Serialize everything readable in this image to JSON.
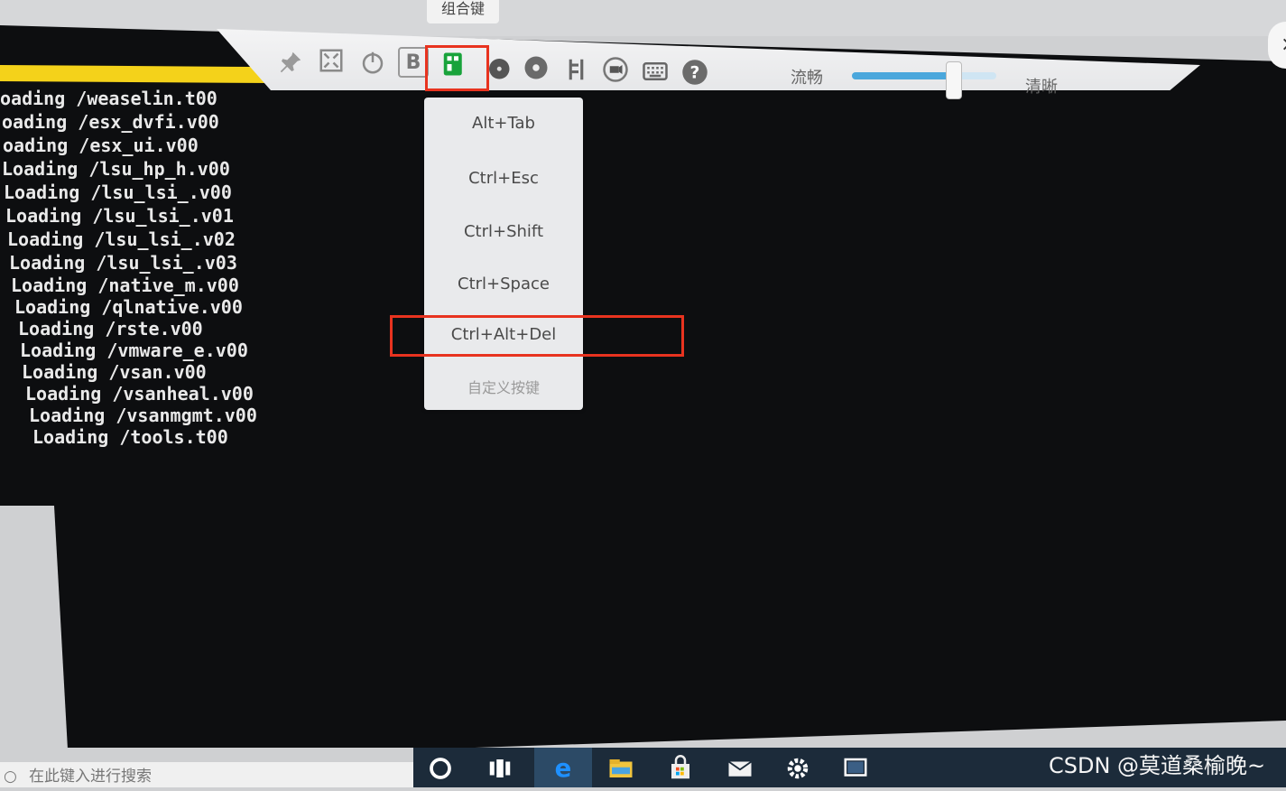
{
  "tooltip": {
    "text": "组合键"
  },
  "toolbar": {
    "icons": [
      "pin-icon",
      "fullscreen-icon",
      "power-icon",
      "b-icon",
      "key-combo-icon",
      "disc-icon",
      "cd-icon",
      "save-icon",
      "record-icon",
      "keyboard-icon",
      "help-icon"
    ],
    "b_label": "B",
    "help_label": "?",
    "quality_low": "流畅",
    "quality_high": "清晰",
    "quality_slider_value": 0.72
  },
  "console": {
    "lines": [
      "oading /weaselin.t00",
      "oading /esx_dvfi.v00",
      "oading /esx_ui.v00",
      "Loading /lsu_hp_h.v00",
      "Loading /lsu_lsi_.v00",
      "Loading /lsu_lsi_.v01",
      "Loading /lsu_lsi_.v02",
      "Loading /lsu_lsi_.v03",
      "Loading /native_m.v00",
      "Loading /qlnative.v00",
      "Loading /rste.v00",
      "Loading /vmware_e.v00",
      "Loading /vsan.v00",
      "Loading /vsanheal.v00",
      "Loading /vsanmgmt.v00",
      "Loading /tools.t00"
    ]
  },
  "menu": {
    "items": [
      "Alt+Tab",
      "Ctrl+Esc",
      "Ctrl+Shift",
      "Ctrl+Space",
      "Ctrl+Alt+Del"
    ],
    "custom": "自定义按键"
  },
  "taskbar": {
    "search_placeholder": "在此键入进行搜索"
  },
  "watermark": "CSDN @莫道桑榆晚~",
  "colors": {
    "highlight": "#e8331f",
    "accent": "#18a33b",
    "taskbar": "#1c2b3a"
  }
}
